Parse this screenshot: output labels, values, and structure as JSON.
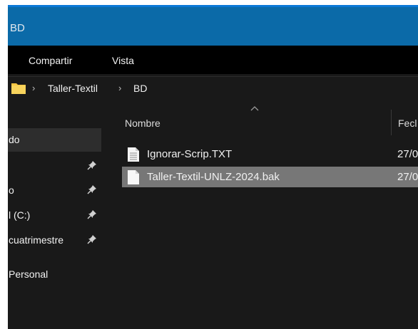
{
  "window": {
    "title": "BD"
  },
  "ribbon": {
    "tabs": [
      "Compartir",
      "Vista"
    ]
  },
  "address_bar": {
    "breadcrumb": [
      "Taller-Textil",
      "BD"
    ],
    "separator": "›"
  },
  "nav_pane": {
    "items": [
      {
        "label": "do",
        "pinned": false,
        "selected": true
      },
      {
        "label": "",
        "pinned": true,
        "selected": false
      },
      {
        "label": "o",
        "pinned": true,
        "selected": false
      },
      {
        "label": "l (C:)",
        "pinned": true,
        "selected": false
      },
      {
        "label": "cuatrimestre",
        "pinned": true,
        "selected": false
      },
      {
        "label": "Personal",
        "pinned": false,
        "selected": false
      }
    ]
  },
  "file_list": {
    "columns": [
      "Nombre",
      "Fecl"
    ],
    "files": [
      {
        "name": "Ignorar-Scrip.TXT",
        "date": "27/0",
        "selected": false
      },
      {
        "name": "Taller-Textil-UNLZ-2024.bak",
        "date": "27/0",
        "selected": true
      }
    ]
  },
  "colors": {
    "title_bar": "#0b6aa8",
    "background": "#191919",
    "ribbon": "#000000",
    "selection": "#777777",
    "folder_icon": "#f5c542"
  }
}
